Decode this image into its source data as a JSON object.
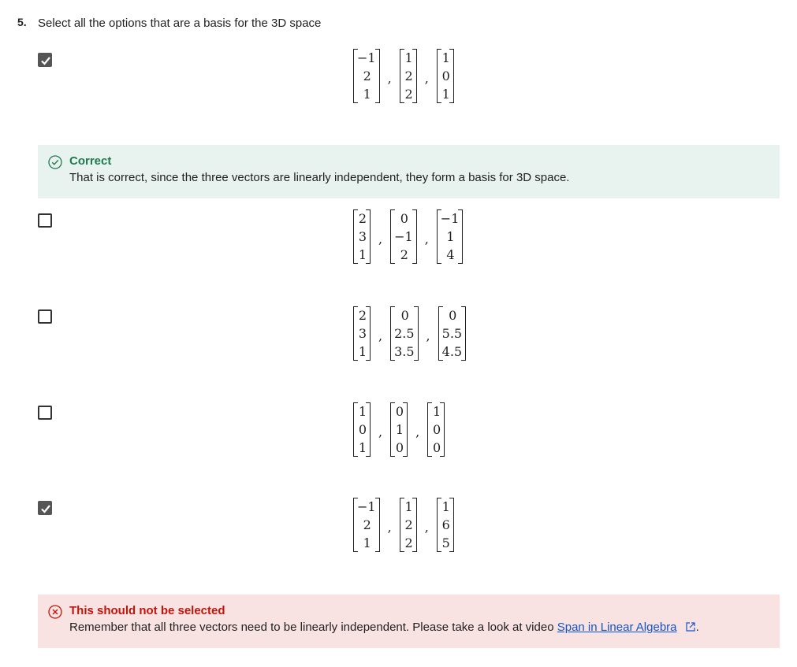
{
  "question": {
    "number": "5.",
    "text": "Select all the options that are a basis for the 3D space"
  },
  "options": [
    {
      "checked": true,
      "vectors": [
        [
          "−1",
          "2",
          "1"
        ],
        [
          "1",
          "2",
          "2"
        ],
        [
          "1",
          "0",
          "1"
        ]
      ]
    },
    {
      "checked": false,
      "vectors": [
        [
          "2",
          "3",
          "1"
        ],
        [
          "0",
          "−1",
          "2"
        ],
        [
          "−1",
          "1",
          "4"
        ]
      ]
    },
    {
      "checked": false,
      "vectors": [
        [
          "2",
          "3",
          "1"
        ],
        [
          "0",
          "2.5",
          "3.5"
        ],
        [
          "0",
          "5.5",
          "4.5"
        ]
      ]
    },
    {
      "checked": false,
      "vectors": [
        [
          "1",
          "0",
          "1"
        ],
        [
          "0",
          "1",
          "0"
        ],
        [
          "1",
          "0",
          "0"
        ]
      ]
    },
    {
      "checked": true,
      "vectors": [
        [
          "−1",
          "2",
          "1"
        ],
        [
          "1",
          "2",
          "2"
        ],
        [
          "1",
          "6",
          "5"
        ]
      ]
    }
  ],
  "feedback_correct": {
    "title": "Correct",
    "body": "That is correct, since the three vectors are linearly independent,  they form a basis for 3D space."
  },
  "feedback_wrong": {
    "title": "This should not be selected",
    "body": "Remember that all three vectors need to be linearly independent. Please take a look at video",
    "link": "Span in Linear Algebra",
    "end": "."
  },
  "colors": {
    "correct_bg": "#e8f2ee",
    "correct_text": "#1e7a4f",
    "wrong_bg": "#f9e2e2",
    "wrong_text": "#c0150b",
    "link": "#1155cc"
  },
  "icons": {
    "correct": "check-circle-icon",
    "wrong": "x-circle-icon",
    "external": "external-link-icon"
  }
}
